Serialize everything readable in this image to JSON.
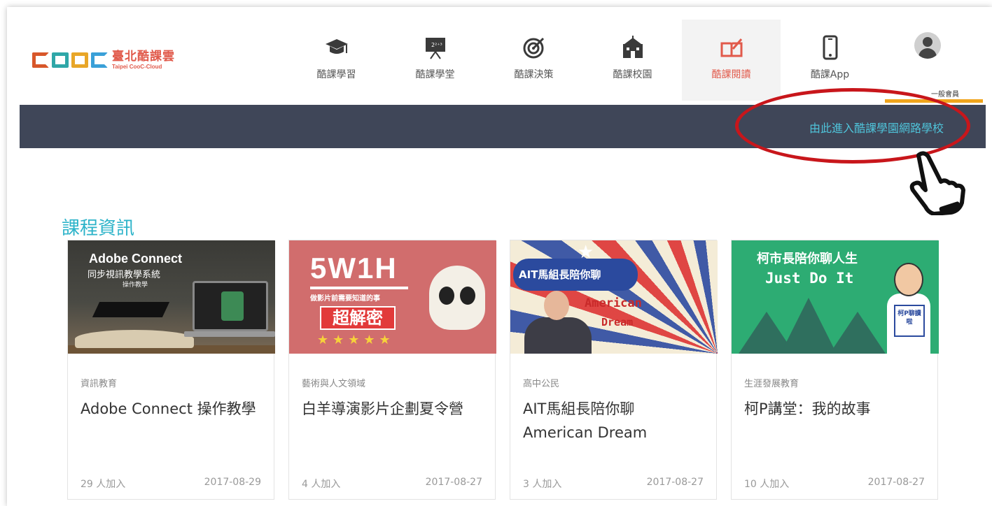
{
  "header": {
    "logo": {
      "cn": "臺北酷課雲",
      "en": "Taipei CooC-Cloud"
    },
    "nav": [
      {
        "label": "酷課學習",
        "icon": "graduation-cap-icon"
      },
      {
        "label": "酷課學堂",
        "icon": "blackboard-icon"
      },
      {
        "label": "酷課決策",
        "icon": "target-icon"
      },
      {
        "label": "酷課校園",
        "icon": "school-building-icon"
      },
      {
        "label": "酷課閱讀",
        "icon": "book-pen-icon",
        "active": true
      },
      {
        "label": "酷課App",
        "icon": "smartphone-icon"
      }
    ],
    "member": {
      "label": "一般會員"
    }
  },
  "banner": {
    "link": "由此進入酷課學園網路學校"
  },
  "colors": {
    "banner_bg": "#3f4658",
    "link": "#4fc3d9",
    "accent_orange": "#f0a51c",
    "section_title": "#2cb3c9",
    "annotation_red": "#c8161b"
  },
  "courses": {
    "title": "課程資訊",
    "cards": [
      {
        "category": "資訊教育",
        "title": "Adobe Connect 操作教學",
        "joined": "29 人加入",
        "date": "2017-08-29",
        "thumb": {
          "line1": "Adobe Connect",
          "line2": "同步視訊教學系統",
          "line3": "操作教學"
        }
      },
      {
        "category": "藝術與人文領域",
        "title": "白羊導演影片企劃夏令營",
        "joined": "4 人加入",
        "date": "2017-08-27",
        "thumb": {
          "line1": "5W1H",
          "line2": "做影片前需要知道的事",
          "line3": "超解密",
          "stars": "★★★★★"
        }
      },
      {
        "category": "高中公民",
        "title": "AIT馬組長陪你聊 American Dream",
        "joined": "3 人加入",
        "date": "2017-08-27",
        "thumb": {
          "line1": "AIT馬組長陪你聊",
          "line2": "American",
          "line3": "Dream"
        }
      },
      {
        "category": "生涯發展教育",
        "title": "柯P講堂：我的故事",
        "joined": "10 人加入",
        "date": "2017-08-27",
        "thumb": {
          "line1": "柯市長陪你聊人生",
          "line2": "Just Do It",
          "line3": "柯P聊讀啦"
        }
      }
    ]
  }
}
